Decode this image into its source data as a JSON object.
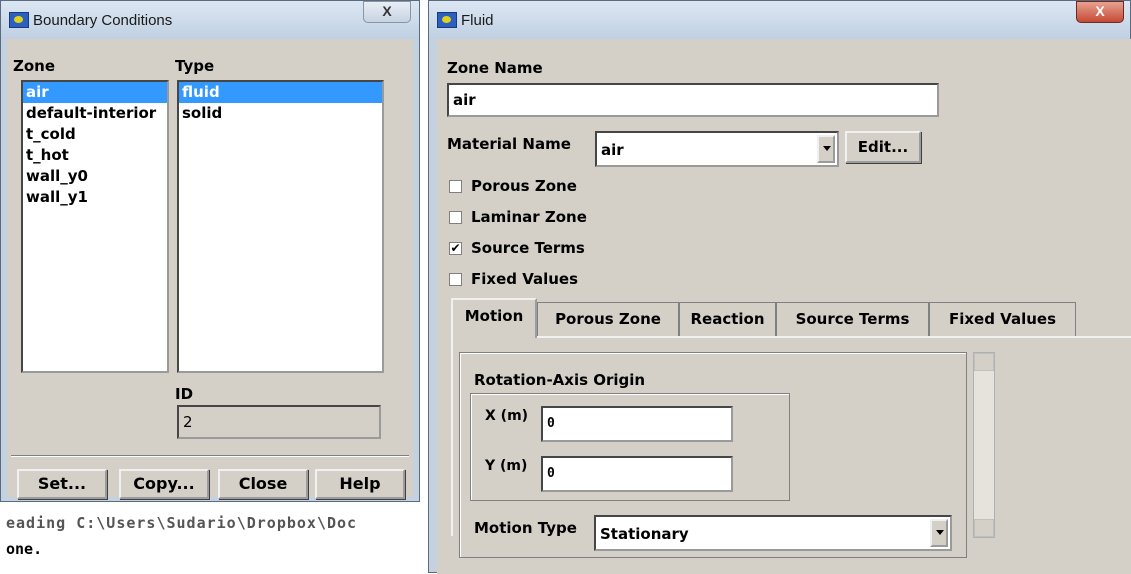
{
  "console": {
    "line1": "eading   C:\\Users\\Sudario\\Dropbox\\Doc",
    "line2": "one."
  },
  "bc_window": {
    "title": "Boundary Conditions",
    "close": "X",
    "zone_label": "Zone",
    "type_label": "Type",
    "zones": [
      "air",
      "default-interior",
      "t_cold",
      "t_hot",
      "wall_y0",
      "wall_y1"
    ],
    "types": [
      "fluid",
      "solid"
    ],
    "id_label": "ID",
    "id_value": "2",
    "buttons": {
      "set": "Set...",
      "copy": "Copy...",
      "close": "Close",
      "help": "Help"
    }
  },
  "fluid_window": {
    "title": "Fluid",
    "close": "X",
    "zone_name_label": "Zone Name",
    "zone_name_value": "air",
    "material_label": "Material Name",
    "material_value": "air",
    "edit_button": "Edit...",
    "checks": {
      "porous": "Porous Zone",
      "laminar": "Laminar Zone",
      "source": "Source Terms",
      "fixed": "Fixed Values"
    },
    "check_mark": "✔",
    "tabs": {
      "motion": "Motion",
      "porous": "Porous Zone",
      "reaction": "Reaction",
      "source": "Source Terms",
      "fixed": "Fixed Values"
    },
    "origin_label": "Rotation-Axis Origin",
    "x_label": "X (m)",
    "x_value": "0",
    "y_label": "Y (m)",
    "y_value": "0",
    "motion_type_label": "Motion Type",
    "motion_type_value": "Stationary"
  }
}
